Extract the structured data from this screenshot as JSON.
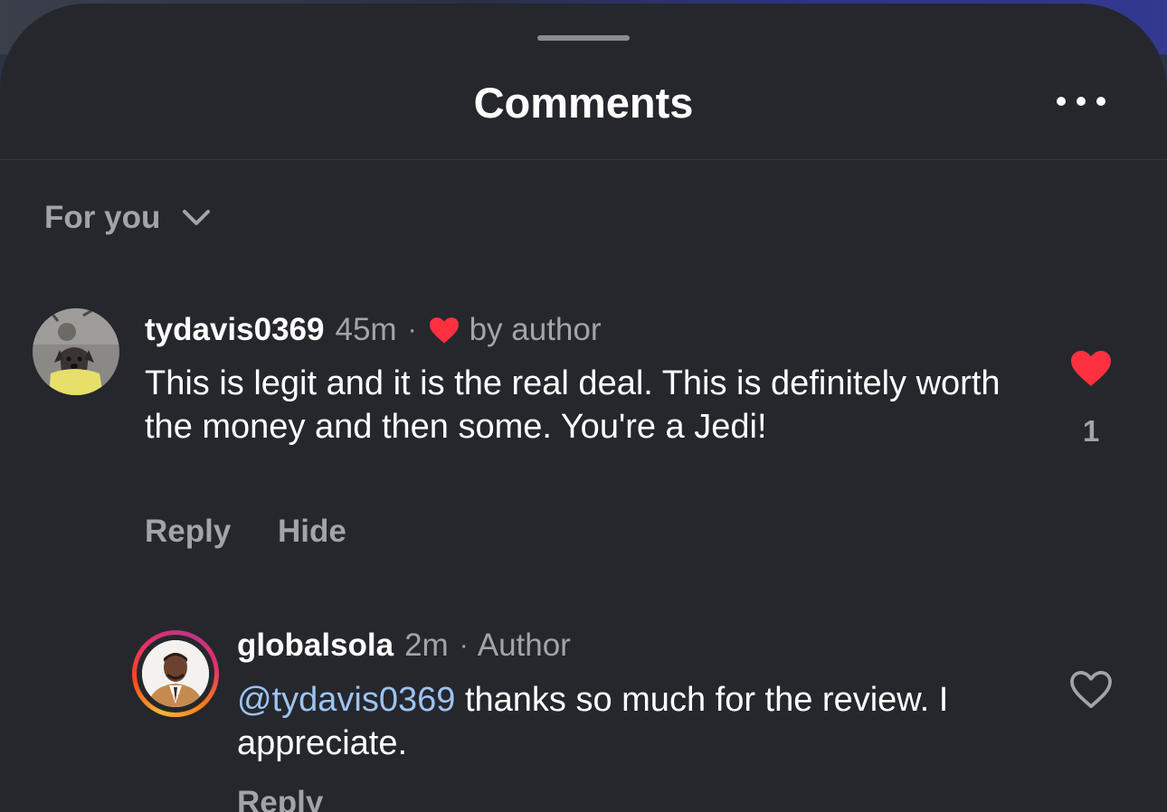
{
  "header": {
    "title": "Comments",
    "more_icon": "more-horizontal-icon"
  },
  "sort": {
    "label": "For you",
    "icon": "chevron-down-icon"
  },
  "comments": [
    {
      "username": "tydavis0369",
      "time": "45m",
      "separator": "·",
      "badge_icon": "heart-filled-icon",
      "badge_text": "by author",
      "text": "This is legit and it is the real deal. This is definitely worth the money and then some. You're a Jedi!",
      "like_icon": "heart-filled-icon",
      "like_color": "#ff3040",
      "like_count": "1",
      "actions": [
        "Reply",
        "Hide"
      ]
    }
  ],
  "reply": {
    "username": "globalsola",
    "time": "2m",
    "separator": "·",
    "author_label": "Author",
    "mention": "@tydavis0369",
    "text": " thanks so much for the review. I appreciate.",
    "like_icon": "heart-outline-icon",
    "actions": [
      "Reply"
    ]
  },
  "colors": {
    "background": "#25272d",
    "text_primary": "#ffffff",
    "text_secondary": "#a2a4a9",
    "mention": "#9cc4f2",
    "like_red": "#ff3040"
  }
}
